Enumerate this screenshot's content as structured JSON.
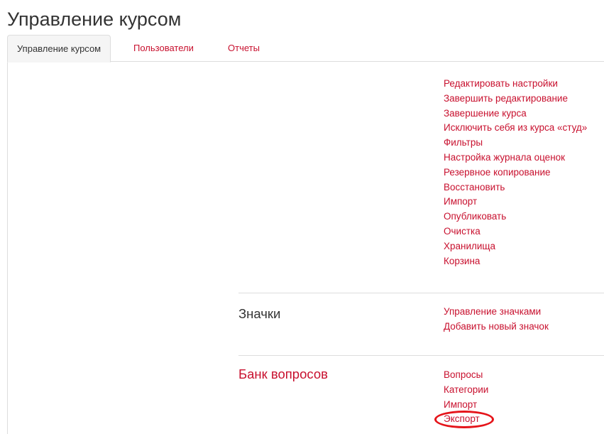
{
  "page": {
    "title": "Управление курсом"
  },
  "tabs": [
    {
      "label": "Управление курсом",
      "active": true
    },
    {
      "label": "Пользователи",
      "active": false
    },
    {
      "label": "Отчеты",
      "active": false
    }
  ],
  "course_admin": {
    "links": [
      "Редактировать настройки",
      "Завершить редактирование",
      "Завершение курса",
      "Исключить себя из курса «студ»",
      "Фильтры",
      "Настройка журнала оценок",
      "Резервное копирование",
      "Восстановить",
      "Импорт",
      "Опубликовать",
      "Очистка",
      "Хранилища",
      "Корзина"
    ]
  },
  "badges": {
    "heading": "Значки",
    "links": [
      "Управление значками",
      "Добавить новый значок"
    ]
  },
  "question_bank": {
    "heading": "Банк вопросов",
    "links": [
      "Вопросы",
      "Категории",
      "Импорт",
      "Экспорт"
    ]
  },
  "colors": {
    "link": "#c8102e",
    "text": "#333333",
    "highlight": "#e5141a"
  }
}
